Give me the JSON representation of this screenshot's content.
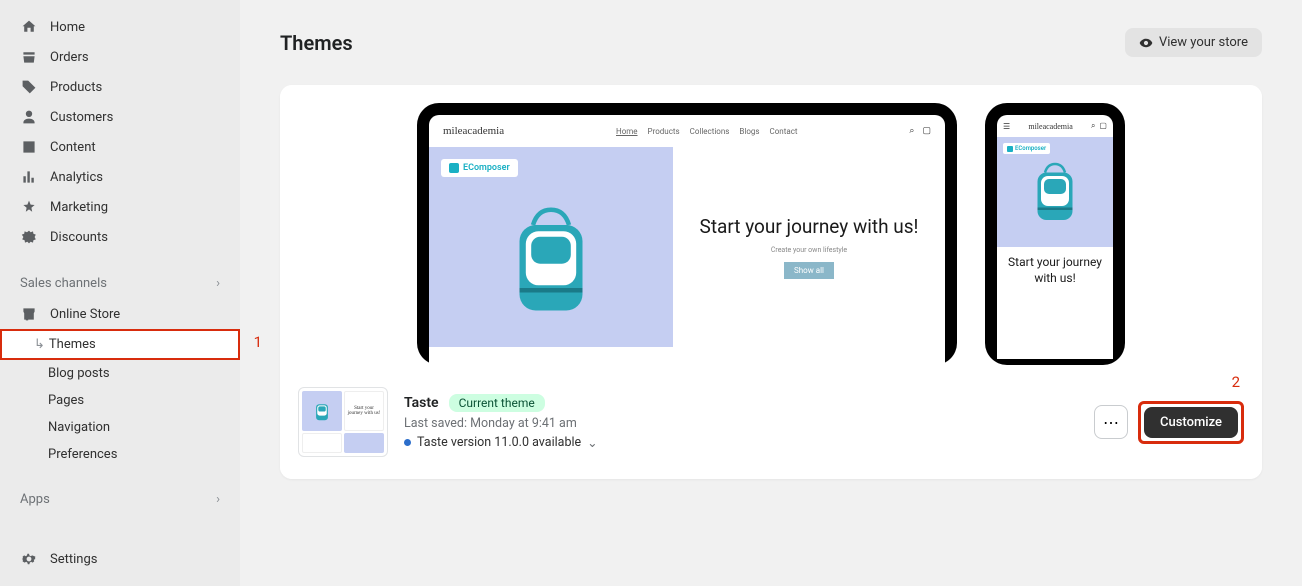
{
  "sidebar": {
    "items": [
      {
        "label": "Home"
      },
      {
        "label": "Orders"
      },
      {
        "label": "Products"
      },
      {
        "label": "Customers"
      },
      {
        "label": "Content"
      },
      {
        "label": "Analytics"
      },
      {
        "label": "Marketing"
      },
      {
        "label": "Discounts"
      }
    ],
    "sales_channels_label": "Sales channels",
    "online_store_label": "Online Store",
    "online_store_children": [
      {
        "label": "Themes"
      },
      {
        "label": "Blog posts"
      },
      {
        "label": "Pages"
      },
      {
        "label": "Navigation"
      },
      {
        "label": "Preferences"
      }
    ],
    "apps_label": "Apps",
    "settings_label": "Settings"
  },
  "header": {
    "title": "Themes",
    "view_store_label": "View your store"
  },
  "preview": {
    "brand": "mileacademia",
    "nav": [
      "Home",
      "Products",
      "Collections",
      "Blogs",
      "Contact"
    ],
    "ecomposer_label": "EComposer",
    "hero_title": "Start your journey with us!",
    "hero_subtitle": "Create your own lifestyle",
    "shop_all_label": "Show all"
  },
  "theme_bar": {
    "name": "Taste",
    "badge": "Current theme",
    "last_saved": "Last saved: Monday at 9:41 am",
    "version_text": "Taste version 11.0.0 available",
    "customize_label": "Customize"
  },
  "annotations": {
    "one": "1",
    "two": "2"
  }
}
